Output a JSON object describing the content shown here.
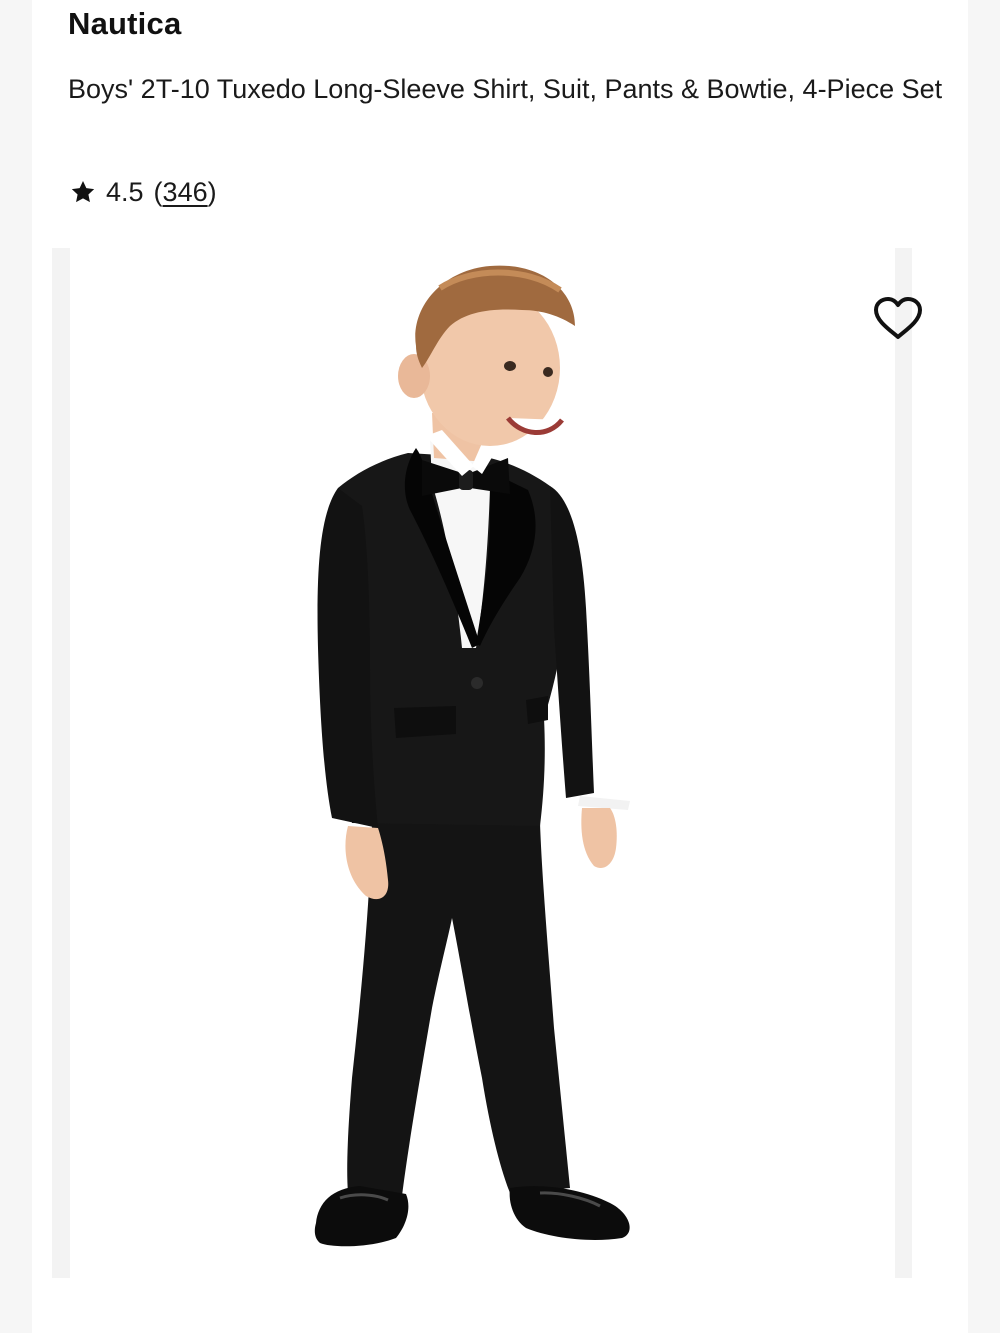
{
  "product": {
    "brand": "Nautica",
    "title": "Boys' 2T-10 Tuxedo Long-Sleeve Shirt, Suit, Pants & Bowtie, 4-Piece Set",
    "rating_value": "4.5",
    "review_open": "(",
    "review_count": "346",
    "review_close": ")"
  },
  "icons": {
    "rating": "star-icon",
    "wishlist": "heart-outline-icon"
  },
  "colors": {
    "text": "#1a1a1a",
    "background": "#ffffff",
    "page_gutter": "#f6f6f6",
    "suit": "#141414"
  }
}
